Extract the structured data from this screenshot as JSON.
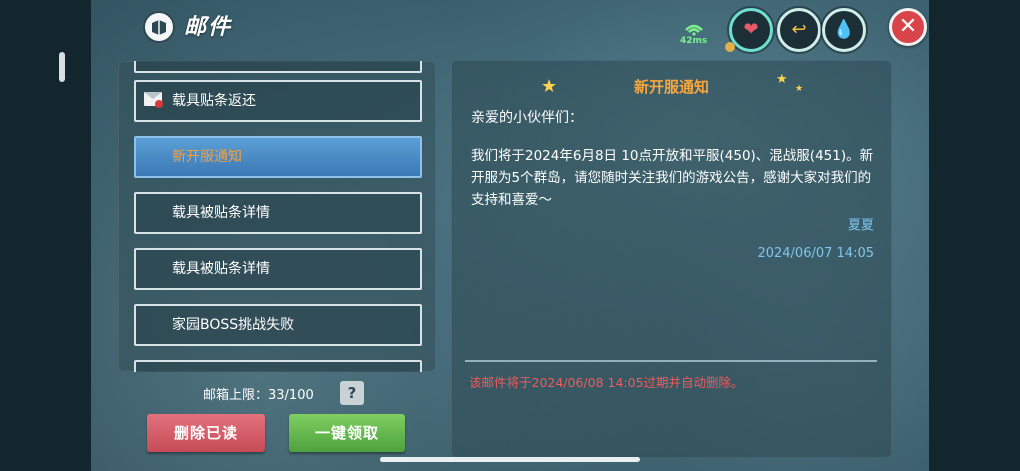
{
  "header": {
    "title": "邮件",
    "ping": "42ms",
    "stats": [
      "heart-icon",
      "arrow-icon",
      "water-drop-icon"
    ],
    "close_label": "✕"
  },
  "mail_list": {
    "items": [
      {
        "label": "载具贴条返还",
        "icon": "envelope-icon",
        "selected": false
      },
      {
        "label": "新开服通知",
        "selected": true
      },
      {
        "label": "载具被贴条详情",
        "selected": false
      },
      {
        "label": "载具被贴条详情",
        "selected": false
      },
      {
        "label": "家园BOSS挑战失败",
        "selected": false
      }
    ],
    "capacity_label": "邮箱上限：33/100",
    "help_label": "?"
  },
  "actions": {
    "delete_read": "删除已读",
    "collect_all": "一键领取"
  },
  "detail": {
    "title": "新开服通知",
    "greeting": "亲爱的小伙伴们：",
    "body": "我们将于2024年6月8日 10点开放和平服(450)、混战服(451)。新开服为5个群岛，请您随时关注我们的游戏公告，感谢大家对我们的支持和喜爱～",
    "sender": "夏夏",
    "date": "2024/06/07 14:05",
    "expiry_notice": "该邮件将于2024/06/08 14:05过期并自动删除。"
  },
  "colors": {
    "accent_orange": "#f7a73d",
    "expiry_red": "#f05b5b",
    "meta_blue": "#7fc5ee",
    "selected_blue": "#4a8cc8",
    "delete_red": "#d25e69",
    "collect_green": "#62b84c"
  }
}
